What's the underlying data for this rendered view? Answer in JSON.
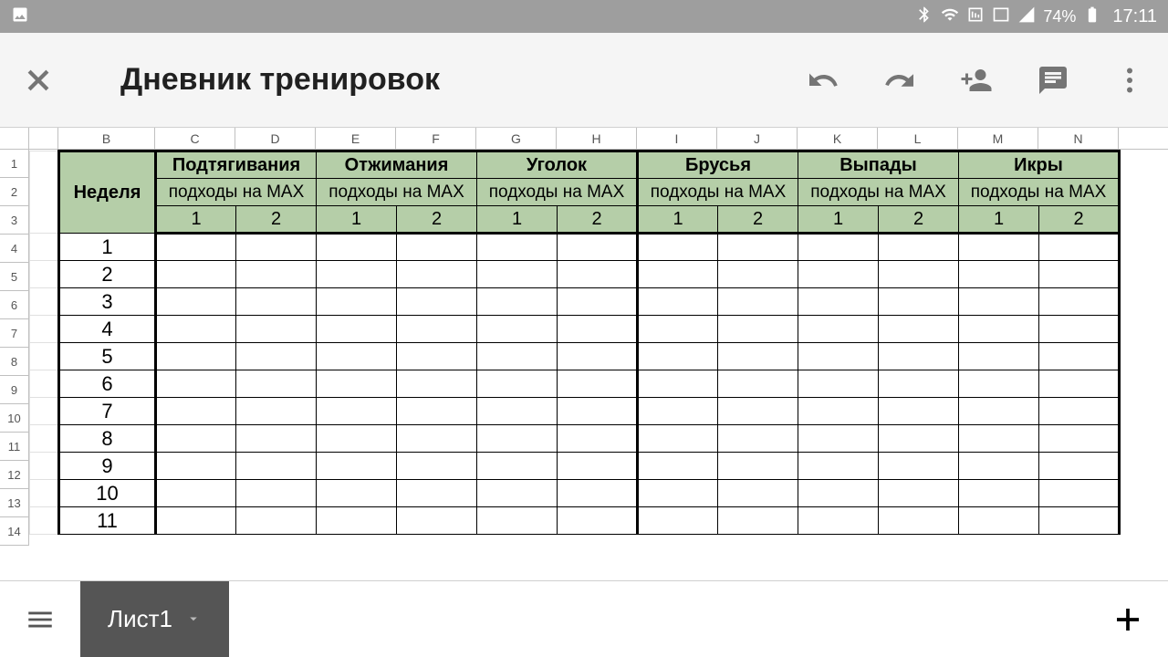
{
  "statusbar": {
    "battery_pct": "74%",
    "clock": "17:11"
  },
  "appbar": {
    "title": "Дневник тренировок"
  },
  "sheet": {
    "col_letters": [
      "B",
      "C",
      "D",
      "E",
      "F",
      "G",
      "H",
      "I",
      "J",
      "K",
      "L",
      "M",
      "N"
    ],
    "row_numbers": [
      "1",
      "2",
      "3",
      "4",
      "5",
      "6",
      "7",
      "8",
      "9",
      "10",
      "11",
      "12",
      "13",
      "14"
    ],
    "week_label": "Неделя",
    "exercises": [
      {
        "name": "Подтягивания",
        "sub": "подходы на MAX",
        "cols": [
          "1",
          "2"
        ]
      },
      {
        "name": "Отжимания",
        "sub": "подходы на MAX",
        "cols": [
          "1",
          "2"
        ]
      },
      {
        "name": "Уголок",
        "sub": "подходы на MAX",
        "cols": [
          "1",
          "2"
        ]
      },
      {
        "name": "Брусья",
        "sub": "подходы на MAX",
        "cols": [
          "1",
          "2"
        ]
      },
      {
        "name": "Выпады",
        "sub": "подходы на MAX",
        "cols": [
          "1",
          "2"
        ]
      },
      {
        "name": "Икры",
        "sub": "подходы на MAX",
        "cols": [
          "1",
          "2"
        ]
      }
    ],
    "weeks": [
      "1",
      "2",
      "3",
      "4",
      "5",
      "6",
      "7",
      "8",
      "9",
      "10",
      "11"
    ]
  },
  "bottombar": {
    "tab_label": "Лист1"
  }
}
